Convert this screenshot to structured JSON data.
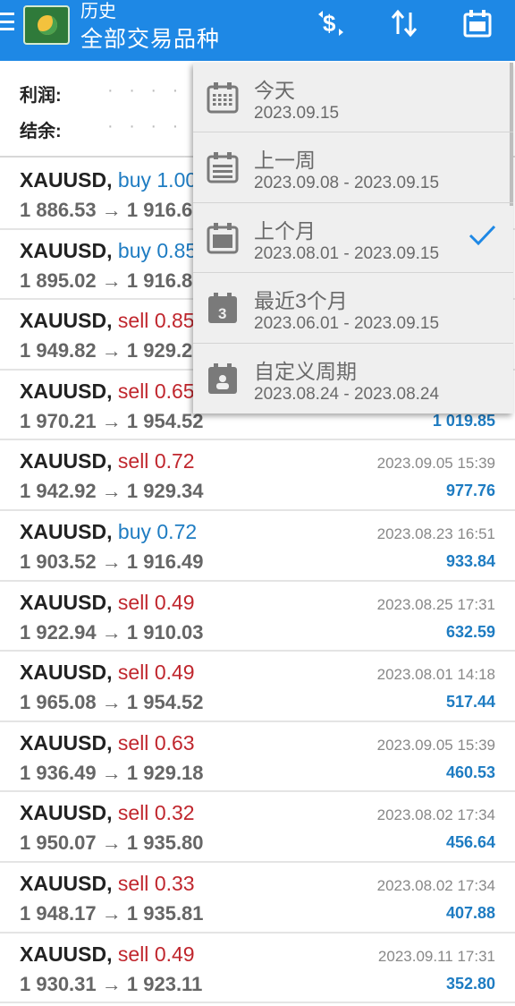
{
  "header": {
    "title": "历史",
    "subtitle": "全部交易品种",
    "accent_color": "#1e88e5"
  },
  "summary": {
    "profit_label": "利润:",
    "balance_label": "结余:",
    "placeholder_dots": "· · · · · ·"
  },
  "period_menu": {
    "items": [
      {
        "label": "今天",
        "range": "2023.09.15",
        "icon": "calendar-day-icon",
        "checked": false
      },
      {
        "label": "上一周",
        "range": "2023.09.08 - 2023.09.15",
        "icon": "calendar-week-icon",
        "checked": false
      },
      {
        "label": "上个月",
        "range": "2023.08.01 - 2023.09.15",
        "icon": "calendar-month-icon",
        "checked": true
      },
      {
        "label": "最近3个月",
        "range": "2023.06.01 - 2023.09.15",
        "icon": "calendar-3-icon",
        "checked": false
      },
      {
        "label": "自定义周期",
        "range": "2023.08.24 - 2023.08.24",
        "icon": "calendar-custom-icon",
        "checked": false
      }
    ]
  },
  "trades": [
    {
      "symbol": "XAUUSD,",
      "side": "buy",
      "lots": "1.00",
      "open": "1 886.53",
      "close": "1 916.6",
      "time": "",
      "profit": ""
    },
    {
      "symbol": "XAUUSD,",
      "side": "buy",
      "lots": "0.85",
      "open": "1 895.02",
      "close": "1 916.8",
      "time": "",
      "profit": ""
    },
    {
      "symbol": "XAUUSD,",
      "side": "sell",
      "lots": "0.85",
      "open": "1 949.82",
      "close": "1 929.2",
      "time": "",
      "profit": ""
    },
    {
      "symbol": "XAUUSD,",
      "side": "sell",
      "lots": "0.65",
      "open": "1 970.21",
      "close": "1 954.52",
      "time": "",
      "profit": "1 019.85"
    },
    {
      "symbol": "XAUUSD,",
      "side": "sell",
      "lots": "0.72",
      "open": "1 942.92",
      "close": "1 929.34",
      "time": "2023.09.05 15:39",
      "profit": "977.76"
    },
    {
      "symbol": "XAUUSD,",
      "side": "buy",
      "lots": "0.72",
      "open": "1 903.52",
      "close": "1 916.49",
      "time": "2023.08.23 16:51",
      "profit": "933.84"
    },
    {
      "symbol": "XAUUSD,",
      "side": "sell",
      "lots": "0.49",
      "open": "1 922.94",
      "close": "1 910.03",
      "time": "2023.08.25 17:31",
      "profit": "632.59"
    },
    {
      "symbol": "XAUUSD,",
      "side": "sell",
      "lots": "0.49",
      "open": "1 965.08",
      "close": "1 954.52",
      "time": "2023.08.01 14:18",
      "profit": "517.44"
    },
    {
      "symbol": "XAUUSD,",
      "side": "sell",
      "lots": "0.63",
      "open": "1 936.49",
      "close": "1 929.18",
      "time": "2023.09.05 15:39",
      "profit": "460.53"
    },
    {
      "symbol": "XAUUSD,",
      "side": "sell",
      "lots": "0.32",
      "open": "1 950.07",
      "close": "1 935.80",
      "time": "2023.08.02 17:34",
      "profit": "456.64"
    },
    {
      "symbol": "XAUUSD,",
      "side": "sell",
      "lots": "0.33",
      "open": "1 948.17",
      "close": "1 935.81",
      "time": "2023.08.02 17:34",
      "profit": "407.88"
    },
    {
      "symbol": "XAUUSD,",
      "side": "sell",
      "lots": "0.49",
      "open": "1 930.31",
      "close": "1 923.11",
      "time": "2023.09.11 17:31",
      "profit": "352.80"
    }
  ],
  "arrow": "→",
  "colors": {
    "buy": "#1e7cc2",
    "sell": "#c0262d",
    "profit": "#1e7cc2"
  }
}
